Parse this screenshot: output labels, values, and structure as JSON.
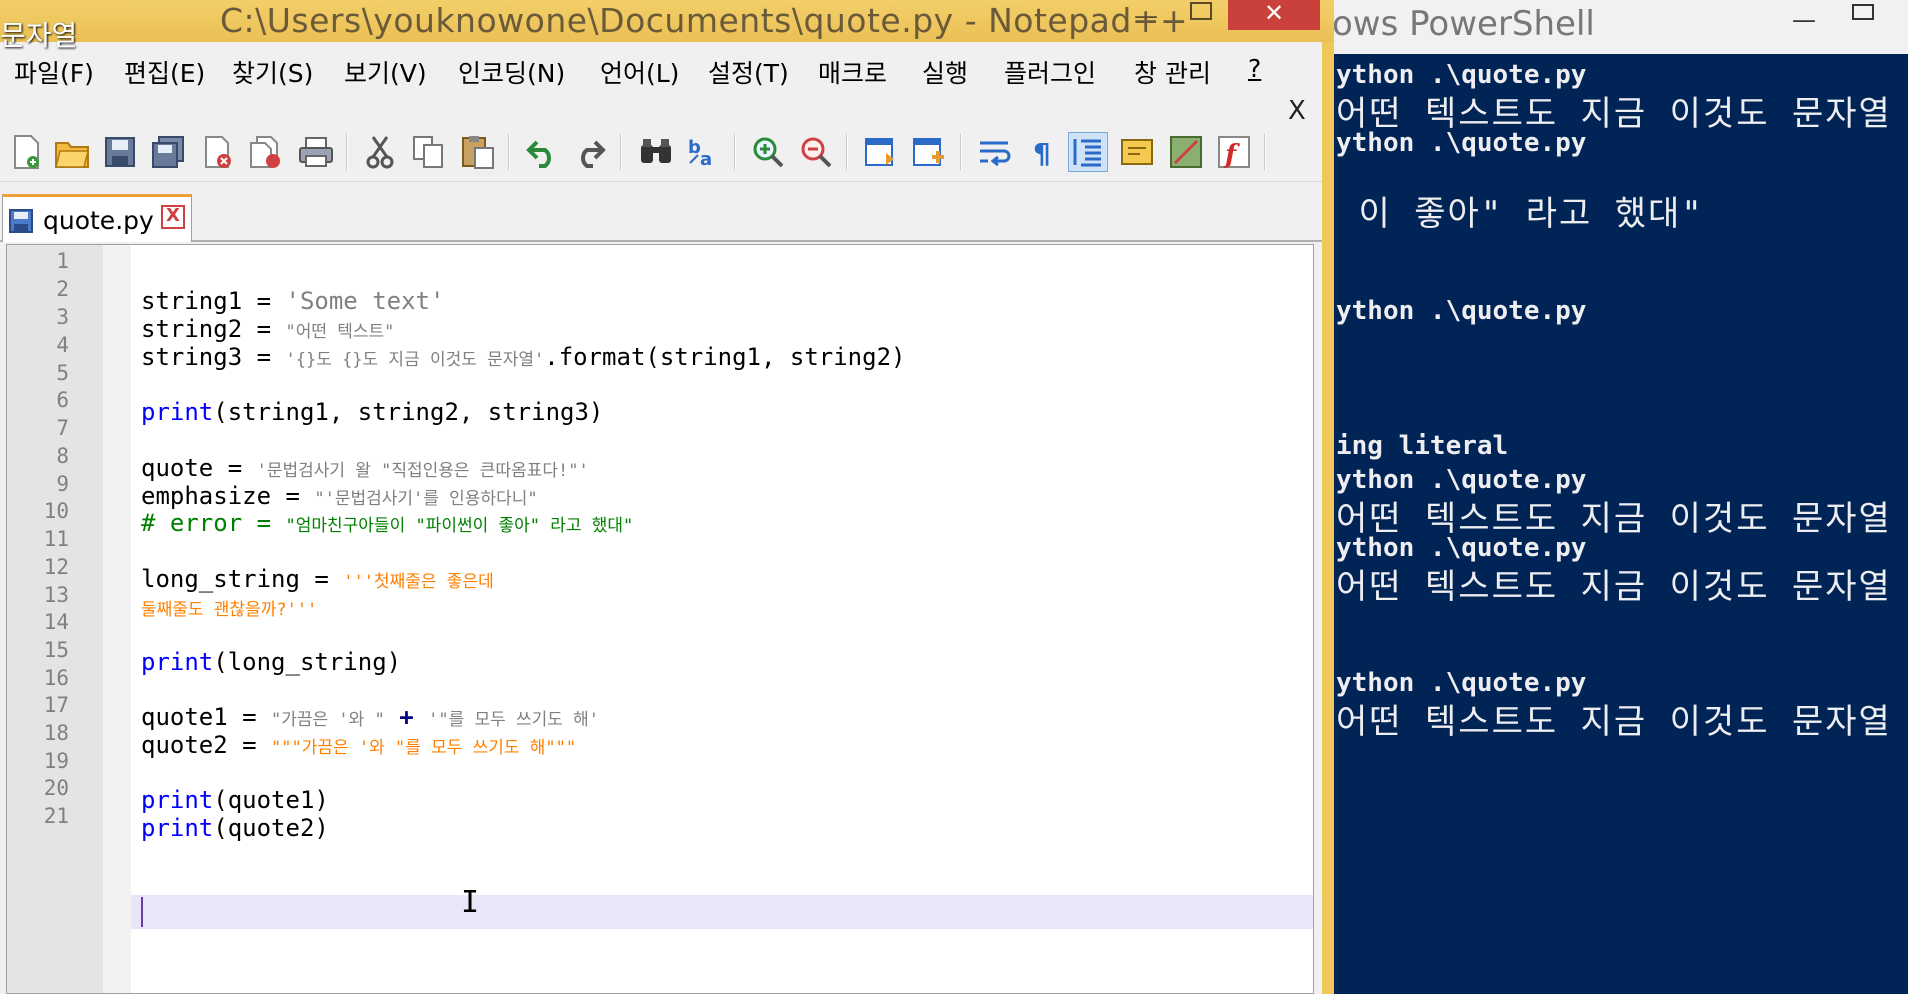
{
  "desktop": {
    "fragment": "문자열"
  },
  "powershell": {
    "title": "ows PowerShell",
    "lines": [
      {
        "kind": "cmd",
        "text": "ython .\\quote.py"
      },
      {
        "kind": "out",
        "text": "어떤 텍스트도 지금 이것도 문자열"
      },
      {
        "kind": "cmd",
        "text": "ython .\\quote.py"
      },
      {
        "kind": "out",
        "text": " 이 좋아\" 라고 했대\""
      },
      {
        "kind": "cmd",
        "text": "ython .\\quote.py"
      },
      {
        "kind": "cmd",
        "text": "ing literal"
      },
      {
        "kind": "cmd",
        "text": "ython .\\quote.py"
      },
      {
        "kind": "out",
        "text": "어떤 텍스트도 지금 이것도 문자열"
      },
      {
        "kind": "cmd",
        "text": "ython .\\quote.py"
      },
      {
        "kind": "out",
        "text": "어떤 텍스트도 지금 이것도 문자열"
      },
      {
        "kind": "cmd",
        "text": "ython .\\quote.py"
      },
      {
        "kind": "out",
        "text": "어떤 텍스트도 지금 이것도 문자열"
      }
    ]
  },
  "notepad": {
    "title": "C:\\Users\\youknowone\\Documents\\quote.py - Notepad++",
    "menu": [
      "파일(F)",
      "편집(E)",
      "찾기(S)",
      "보기(V)",
      "인코딩(N)",
      "언어(L)",
      "설정(T)",
      "매크로",
      "실행",
      "플러그인",
      "창 관리",
      "?"
    ],
    "doc_close": "X",
    "toolbar_icons": [
      "new-file-icon",
      "open-file-icon",
      "save-icon",
      "save-all-icon",
      "close-icon",
      "close-all-icon",
      "print-icon",
      "cut-icon",
      "copy-icon",
      "paste-icon",
      "undo-icon",
      "redo-icon",
      "find-icon",
      "replace-icon",
      "zoom-in-icon",
      "zoom-out-icon",
      "sync-vertical-icon",
      "sync-horizontal-icon",
      "word-wrap-icon",
      "show-all-characters-icon",
      "indent-guide-icon",
      "user-language-icon",
      "document-map-icon",
      "function-list-icon"
    ],
    "tab": {
      "label": "quote.py",
      "close": "X"
    },
    "line_numbers": [
      "1",
      "2",
      "3",
      "4",
      "5",
      "6",
      "7",
      "8",
      "9",
      "10",
      "11",
      "12",
      "13",
      "14",
      "15",
      "16",
      "17",
      "18",
      "19",
      "20",
      "21"
    ],
    "code": {
      "l2a": "string1 = ",
      "l2b": "'Some text'",
      "l3a": "string2 = ",
      "l3b": "\"어떤 텍스트\"",
      "l4a": "string3 = ",
      "l4b": "'{}도 {}도 지금 이것도 문자열'",
      "l4c": ".format(string1, string2)",
      "l6a": "print",
      "l6b": "(string1, string2, string3)",
      "l8a": "quote = ",
      "l8b": "'문법검사기 왈 \"직접인용은 큰따옴표다!\"'",
      "l9a": "emphasize = ",
      "l9b": "\"'문법검사기'를 인용하다니\"",
      "l10a": "# error = ",
      "l10b": "\"엄마친구아들이 \"파이썬이 좋아\" 라고 했대\"",
      "l12a": "long_string = ",
      "l12b": "'''첫째줄은 좋은데",
      "l13a": "둘째줄도 괜찮을까?'''",
      "l15a": "print",
      "l15b": "(long_string)",
      "l17a": "quote1 = ",
      "l17b": "\"가끔은 '와 \"",
      "l17c": " + ",
      "l17d": "'\"를 모두 쓰기도 해'",
      "l18a": "quote2 = ",
      "l18b": "\"\"\"가끔은 '와 \"를 모두 쓰기도 해\"\"\"",
      "l20a": "print",
      "l20b": "(quote1)",
      "l21a": "print",
      "l21b": "(quote2)"
    }
  }
}
